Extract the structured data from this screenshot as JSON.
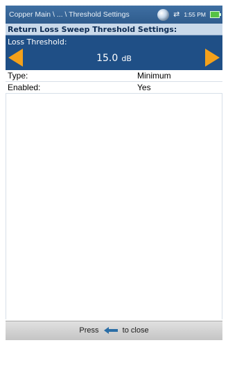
{
  "titlebar": {
    "breadcrumb": "Copper Main \\ ... \\ Threshold Settings",
    "time": "1:55 PM"
  },
  "section": {
    "title": "Return Loss Sweep Threshold Settings:"
  },
  "threshold": {
    "label": "Loss Threshold:",
    "value": "15.0",
    "unit": "dB"
  },
  "properties": [
    {
      "key": "Type:",
      "value": "Minimum"
    },
    {
      "key": "Enabled:",
      "value": "Yes"
    }
  ],
  "help": {
    "before": "Press",
    "after": "to close"
  },
  "colors": {
    "accent": "#f4a11b",
    "panel": "#1f4f86",
    "titlebar": "#2f5c8d"
  }
}
